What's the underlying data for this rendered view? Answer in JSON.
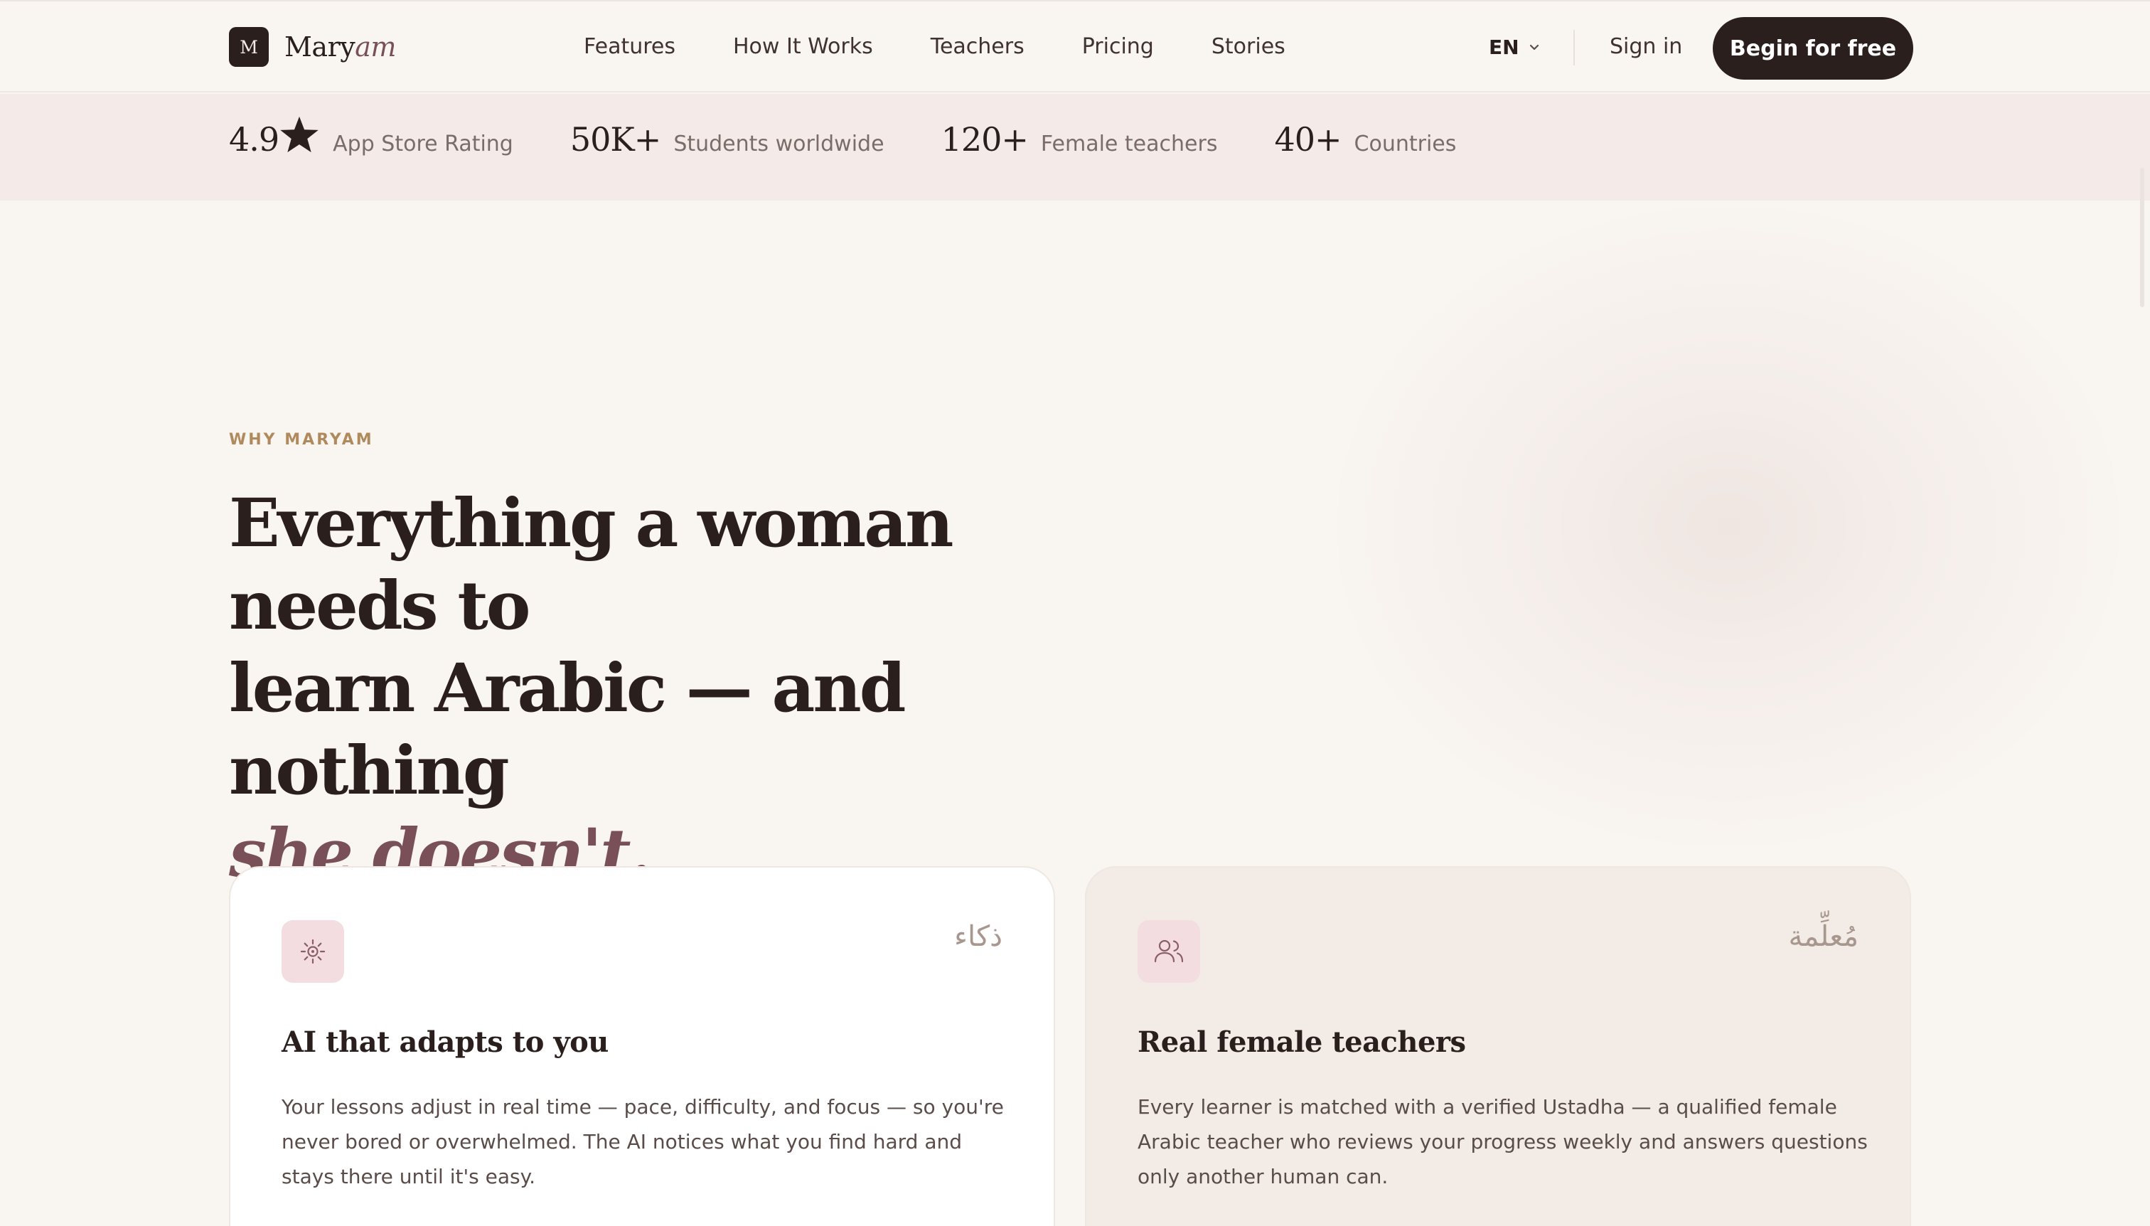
{
  "header": {
    "logo_mark": "M",
    "logo_text_regular": "Mary",
    "logo_text_italic": "am",
    "nav": [
      "Features",
      "How It Works",
      "Teachers",
      "Pricing",
      "Stories"
    ],
    "language": "EN",
    "sign_in": "Sign in",
    "cta": "Begin for free"
  },
  "stats": [
    {
      "value": "4.9",
      "label": "App Store Rating",
      "icon": "star-icon"
    },
    {
      "value": "50K+",
      "label": "Students worldwide"
    },
    {
      "value": "120+",
      "label": "Female teachers"
    },
    {
      "value": "40+",
      "label": "Countries"
    }
  ],
  "section": {
    "eyebrow": "WHY MARYAM",
    "headline_line1": "Everything a woman needs to",
    "headline_line2": "learn Arabic — and nothing",
    "headline_accent": "she doesn't."
  },
  "cards": [
    {
      "icon": "ai-sparkle-icon",
      "arabic": "ذكاء",
      "title": "AI that adapts to you",
      "body": "Your lessons adjust in real time — pace, difficulty, and focus — so you're never bored or overwhelmed. The AI notices what you find hard and stays there until it's easy."
    },
    {
      "icon": "users-icon",
      "arabic": "مُعلِّمة",
      "title": "Real female teachers",
      "body": "Every learner is matched with a verified Ustadha — a qualified female Arabic teacher who reviews your progress weekly and answers questions only another human can."
    }
  ],
  "colors": {
    "brand_dark": "#2a1f1d",
    "accent_plum": "#7a5058",
    "eyebrow_gold": "#b08a5c",
    "icon_bg": "#f4dde0",
    "page_bg": "#f9f5f1"
  }
}
